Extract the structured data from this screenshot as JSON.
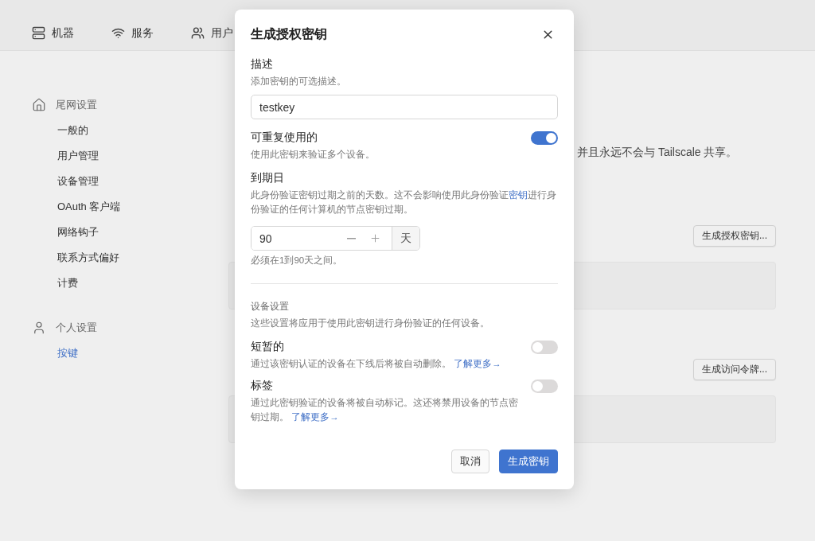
{
  "nav": [
    {
      "label": "机器"
    },
    {
      "label": "服务"
    },
    {
      "label": "用户"
    }
  ],
  "sidebar": {
    "groups": [
      {
        "label": "尾网设置",
        "items": [
          {
            "label": "一般的",
            "selected": false
          },
          {
            "label": "用户管理",
            "selected": false
          },
          {
            "label": "设备管理",
            "selected": false
          },
          {
            "label": "OAuth 客户端",
            "selected": false
          },
          {
            "label": "网络钩子",
            "selected": false
          },
          {
            "label": "联系方式偏好",
            "selected": false
          },
          {
            "label": "计费",
            "selected": false
          }
        ]
      },
      {
        "label": "个人设置",
        "items": [
          {
            "label": "按键",
            "selected": true
          }
        ]
      }
    ]
  },
  "main": {
    "description_tail": "并且永远不会与 Tailscale 共享。",
    "sections": [
      {
        "button": "生成授权密钥..."
      },
      {
        "button": "生成访问令牌..."
      }
    ]
  },
  "dialog": {
    "title": "生成授权密钥",
    "description": {
      "label": "描述",
      "hint": "添加密钥的可选描述。",
      "value": "testkey"
    },
    "reusable": {
      "label": "可重复使用的",
      "hint": "使用此密钥来验证多个设备。",
      "on": true
    },
    "expiration": {
      "label": "到期日",
      "hint_before": "此身份验证密钥过期之前的天数。这不会影响使用此身份验证",
      "hint_link": "密钥",
      "hint_after": "进行身份验证的任何计算机的节点密钥过期。",
      "value": "90",
      "unit": "天",
      "note": "必须在1到90天之间。"
    },
    "device_settings": {
      "heading": "设备设置",
      "hint": "这些设置将应用于使用此密钥进行身份验证的任何设备。",
      "toggles": [
        {
          "label": "短暂的",
          "hint": "通过该密钥认证的设备在下线后将被自动删除。",
          "link": "了解更多→",
          "on": false
        },
        {
          "label": "标签",
          "hint": "通过此密钥验证的设备将被自动标记。这还将禁用设备的节点密钥过期。",
          "link": "了解更多→",
          "on": false
        }
      ]
    },
    "buttons": {
      "cancel": "取消",
      "submit": "生成密钥"
    }
  }
}
